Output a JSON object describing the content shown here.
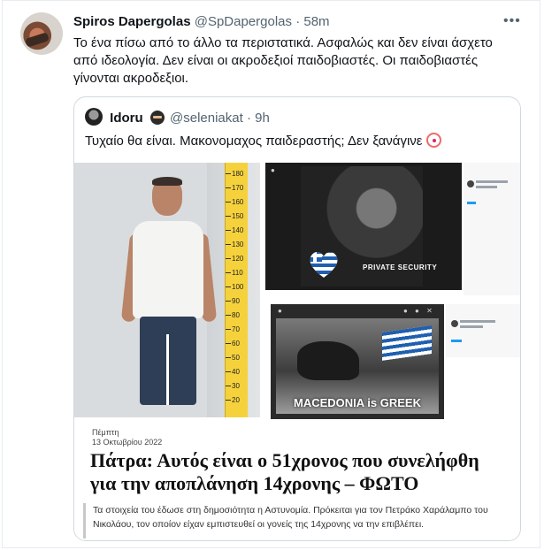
{
  "tweet": {
    "author_name": "Spiros Dapergolas",
    "author_handle": "@SpDapergolas",
    "separator": "·",
    "time": "58m",
    "more_icon": "more-dots-icon",
    "text_lines": [
      "Το ένα πίσω από το άλλο τα περιστατικά. Ασφαλώς και δεν είναι άσχετο",
      "από ιδεολογία. Δεν είναι οι ακροδεξιοί παιδοβιαστές. Οι παιδοβιαστές",
      "γίνονται ακροδεξιοι."
    ]
  },
  "quote": {
    "author_name": "Idoru",
    "badge_icon": "ninja-emoji-icon",
    "author_handle": "@seleniakat",
    "separator": "·",
    "time": "9h",
    "text": "Τυχαίο θα είναι. Μακονομαχος παιδεραστής; Δεν ξανάγινε",
    "trailing_emoji": "clown-face-icon"
  },
  "media": {
    "ruler_ticks": [
      "180",
      "170",
      "160",
      "150",
      "140",
      "130",
      "120",
      "110",
      "100",
      "90",
      "80",
      "70",
      "60",
      "50",
      "40",
      "30",
      "20"
    ],
    "private_security_label": "PRIVATE SECURITY",
    "macedonia_label": "MACEDONIA is GREEK",
    "article_day": "Πέμπτη",
    "article_date": "13 Οκτωβρίου 2022",
    "article_title_lines": [
      "Πάτρα: Αυτός είναι ο 51χρονος που συνελήφθη",
      "για την αποπλάνηση 14χρονης – ΦΩΤΟ"
    ],
    "article_lead_lines": [
      "Τα στοιχεία του έδωσε στη δημοσιότητα η Αστυνομία. Πρόκειται για τον Πετράκο Χαράλαμπο του",
      "Νικολάου, τον οποίον είχαν εμπιστευθεί οι γονείς της 14χρονης να την επιβλέπει."
    ]
  }
}
